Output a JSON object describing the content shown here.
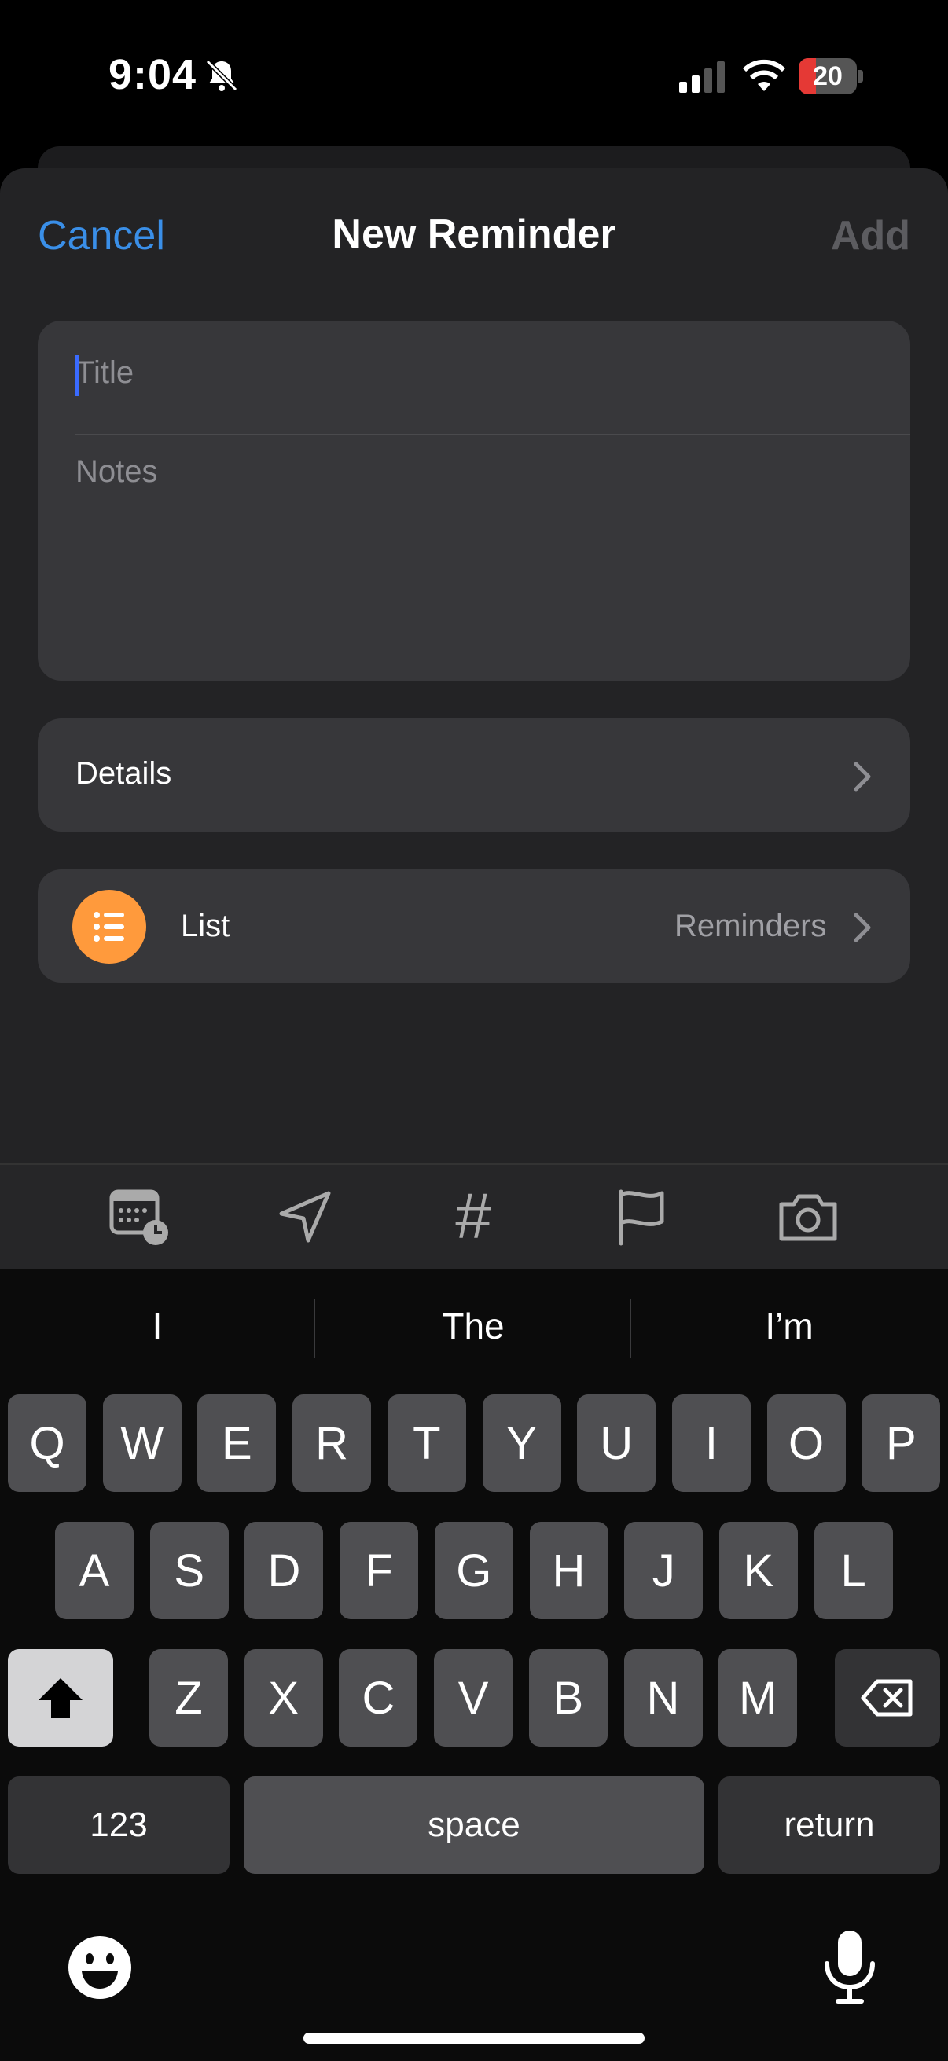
{
  "status_bar": {
    "time": "9:04",
    "battery": "20"
  },
  "nav": {
    "cancel": "Cancel",
    "title": "New Reminder",
    "add": "Add"
  },
  "form": {
    "title_placeholder": "Title",
    "notes_placeholder": "Notes"
  },
  "details": {
    "label": "Details"
  },
  "list": {
    "label": "List",
    "value": "Reminders"
  },
  "toolbar": {
    "icons": [
      "calendar-clock-icon",
      "location-arrow-icon",
      "hashtag-icon",
      "flag-icon",
      "camera-icon"
    ]
  },
  "suggestions": [
    "I",
    "The",
    "I’m"
  ],
  "keyboard": {
    "row1": [
      "Q",
      "W",
      "E",
      "R",
      "T",
      "Y",
      "U",
      "I",
      "O",
      "P"
    ],
    "row2": [
      "A",
      "S",
      "D",
      "F",
      "G",
      "H",
      "J",
      "K",
      "L"
    ],
    "row3": [
      "Z",
      "X",
      "C",
      "V",
      "B",
      "N",
      "M"
    ],
    "numbers_key": "123",
    "space_key": "space",
    "return_key": "return"
  },
  "colors": {
    "accent": "#3a8fe8",
    "list_icon": "#ff9a3c",
    "sheet": "#232325",
    "card": "#37373a"
  }
}
